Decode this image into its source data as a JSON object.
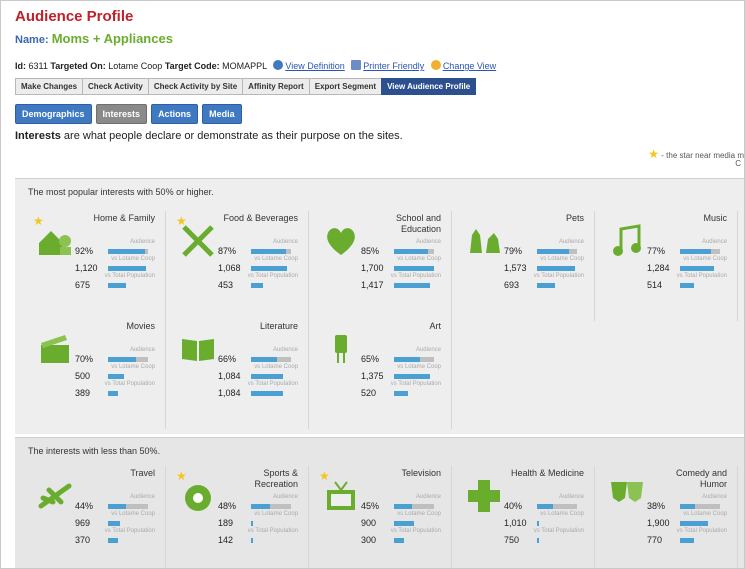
{
  "header": {
    "title": "Audience Profile",
    "name_label": "Name:",
    "name_value": "Moms + Appliances",
    "id_prefix": "Id:",
    "id_value": "6311",
    "targeted_on_label": "Targeted On:",
    "targeted_on_value": "Lotame Coop",
    "target_code_label": "Target Code:",
    "target_code_value": "MOMAPPL",
    "links": [
      "View Definition",
      "Printer Friendly",
      "Change View"
    ]
  },
  "tabs": [
    "Make Changes",
    "Check Activity",
    "Check Activity by Site",
    "Affinity Report",
    "Export Segment",
    "View Audience Profile"
  ],
  "active_tab": 5,
  "subtabs": [
    "Demographics",
    "Interests",
    "Actions",
    "Media"
  ],
  "selected_subtab": 1,
  "description": {
    "bold": "Interests",
    "rest": " are what people declare or demonstrate as their purpose on the sites."
  },
  "star_note": {
    "line1": "- the star near media m",
    "line2": "C"
  },
  "colors": {
    "accent": "#6aad2e",
    "bar": "#4a9fd3",
    "title": "#c0202a",
    "tab_active": "#2c4f8f"
  },
  "panel_high": {
    "label": "The most popular interests with 50% or higher.",
    "cards": [
      {
        "name": "Home & Family",
        "icon": "house-family-icon",
        "star": true,
        "pct": "92%",
        "pct_num": 92,
        "coop": "1,120",
        "coop_num": 0.95,
        "pop": "675",
        "pop_num": 0.45
      },
      {
        "name": "Food & Beverages",
        "icon": "fork-knife-icon",
        "star": true,
        "pct": "87%",
        "pct_num": 87,
        "coop": "1,068",
        "coop_num": 0.9,
        "pop": "453",
        "pop_num": 0.3
      },
      {
        "name": "School and Education",
        "icon": "book-heart-icon",
        "star": false,
        "pct": "85%",
        "pct_num": 85,
        "coop": "1,700",
        "coop_num": 1.0,
        "pop": "1,417",
        "pop_num": 0.9
      },
      {
        "name": "Pets",
        "icon": "pets-icon",
        "star": false,
        "pct": "79%",
        "pct_num": 79,
        "coop": "1,573",
        "coop_num": 0.95,
        "pop": "693",
        "pop_num": 0.45
      },
      {
        "name": "Music",
        "icon": "music-note-icon",
        "star": false,
        "pct": "77%",
        "pct_num": 77,
        "coop": "1,284",
        "coop_num": 0.85,
        "pop": "514",
        "pop_num": 0.35
      },
      {
        "name": "Movies",
        "icon": "clapboard-icon",
        "star": false,
        "pct": "70%",
        "pct_num": 70,
        "coop": "500",
        "coop_num": 0.4,
        "pop": "389",
        "pop_num": 0.25
      },
      {
        "name": "Literature",
        "icon": "open-book-icon",
        "star": false,
        "pct": "66%",
        "pct_num": 66,
        "coop": "1,084",
        "coop_num": 0.8,
        "pop": "1,084",
        "pop_num": 0.8
      },
      {
        "name": "Art",
        "icon": "paint-icon",
        "star": false,
        "pct": "65%",
        "pct_num": 65,
        "coop": "1,375",
        "coop_num": 0.9,
        "pop": "520",
        "pop_num": 0.35
      }
    ]
  },
  "panel_low": {
    "label": "The interests with less than 50%.",
    "cards": [
      {
        "name": "Travel",
        "icon": "airplane-icon",
        "star": false,
        "pct": "44%",
        "pct_num": 44,
        "coop": "969",
        "coop_num": 0.3,
        "pop": "370",
        "pop_num": 0.25
      },
      {
        "name": "Sports & Recreation",
        "icon": "soccer-ball-icon",
        "star": true,
        "pct": "48%",
        "pct_num": 48,
        "coop": "189",
        "coop_num": 0.05,
        "pop": "142",
        "pop_num": 0.05
      },
      {
        "name": "Television",
        "icon": "tv-icon",
        "star": true,
        "pct": "45%",
        "pct_num": 45,
        "coop": "900",
        "coop_num": 0.5,
        "pop": "300",
        "pop_num": 0.25
      },
      {
        "name": "Health & Medicine",
        "icon": "medical-cross-icon",
        "star": false,
        "pct": "40%",
        "pct_num": 40,
        "coop": "1,010",
        "coop_num": 0.05,
        "pop": "750",
        "pop_num": 0.05
      },
      {
        "name": "Comedy and Humor",
        "icon": "comedy-mask-icon",
        "star": false,
        "pct": "38%",
        "pct_num": 38,
        "coop": "1,900",
        "coop_num": 0.7,
        "pop": "770",
        "pop_num": 0.35
      }
    ]
  },
  "metric_labels": {
    "audience": "Audience",
    "coop": "vs Lotame Coop",
    "pop": "vs Total Population"
  }
}
